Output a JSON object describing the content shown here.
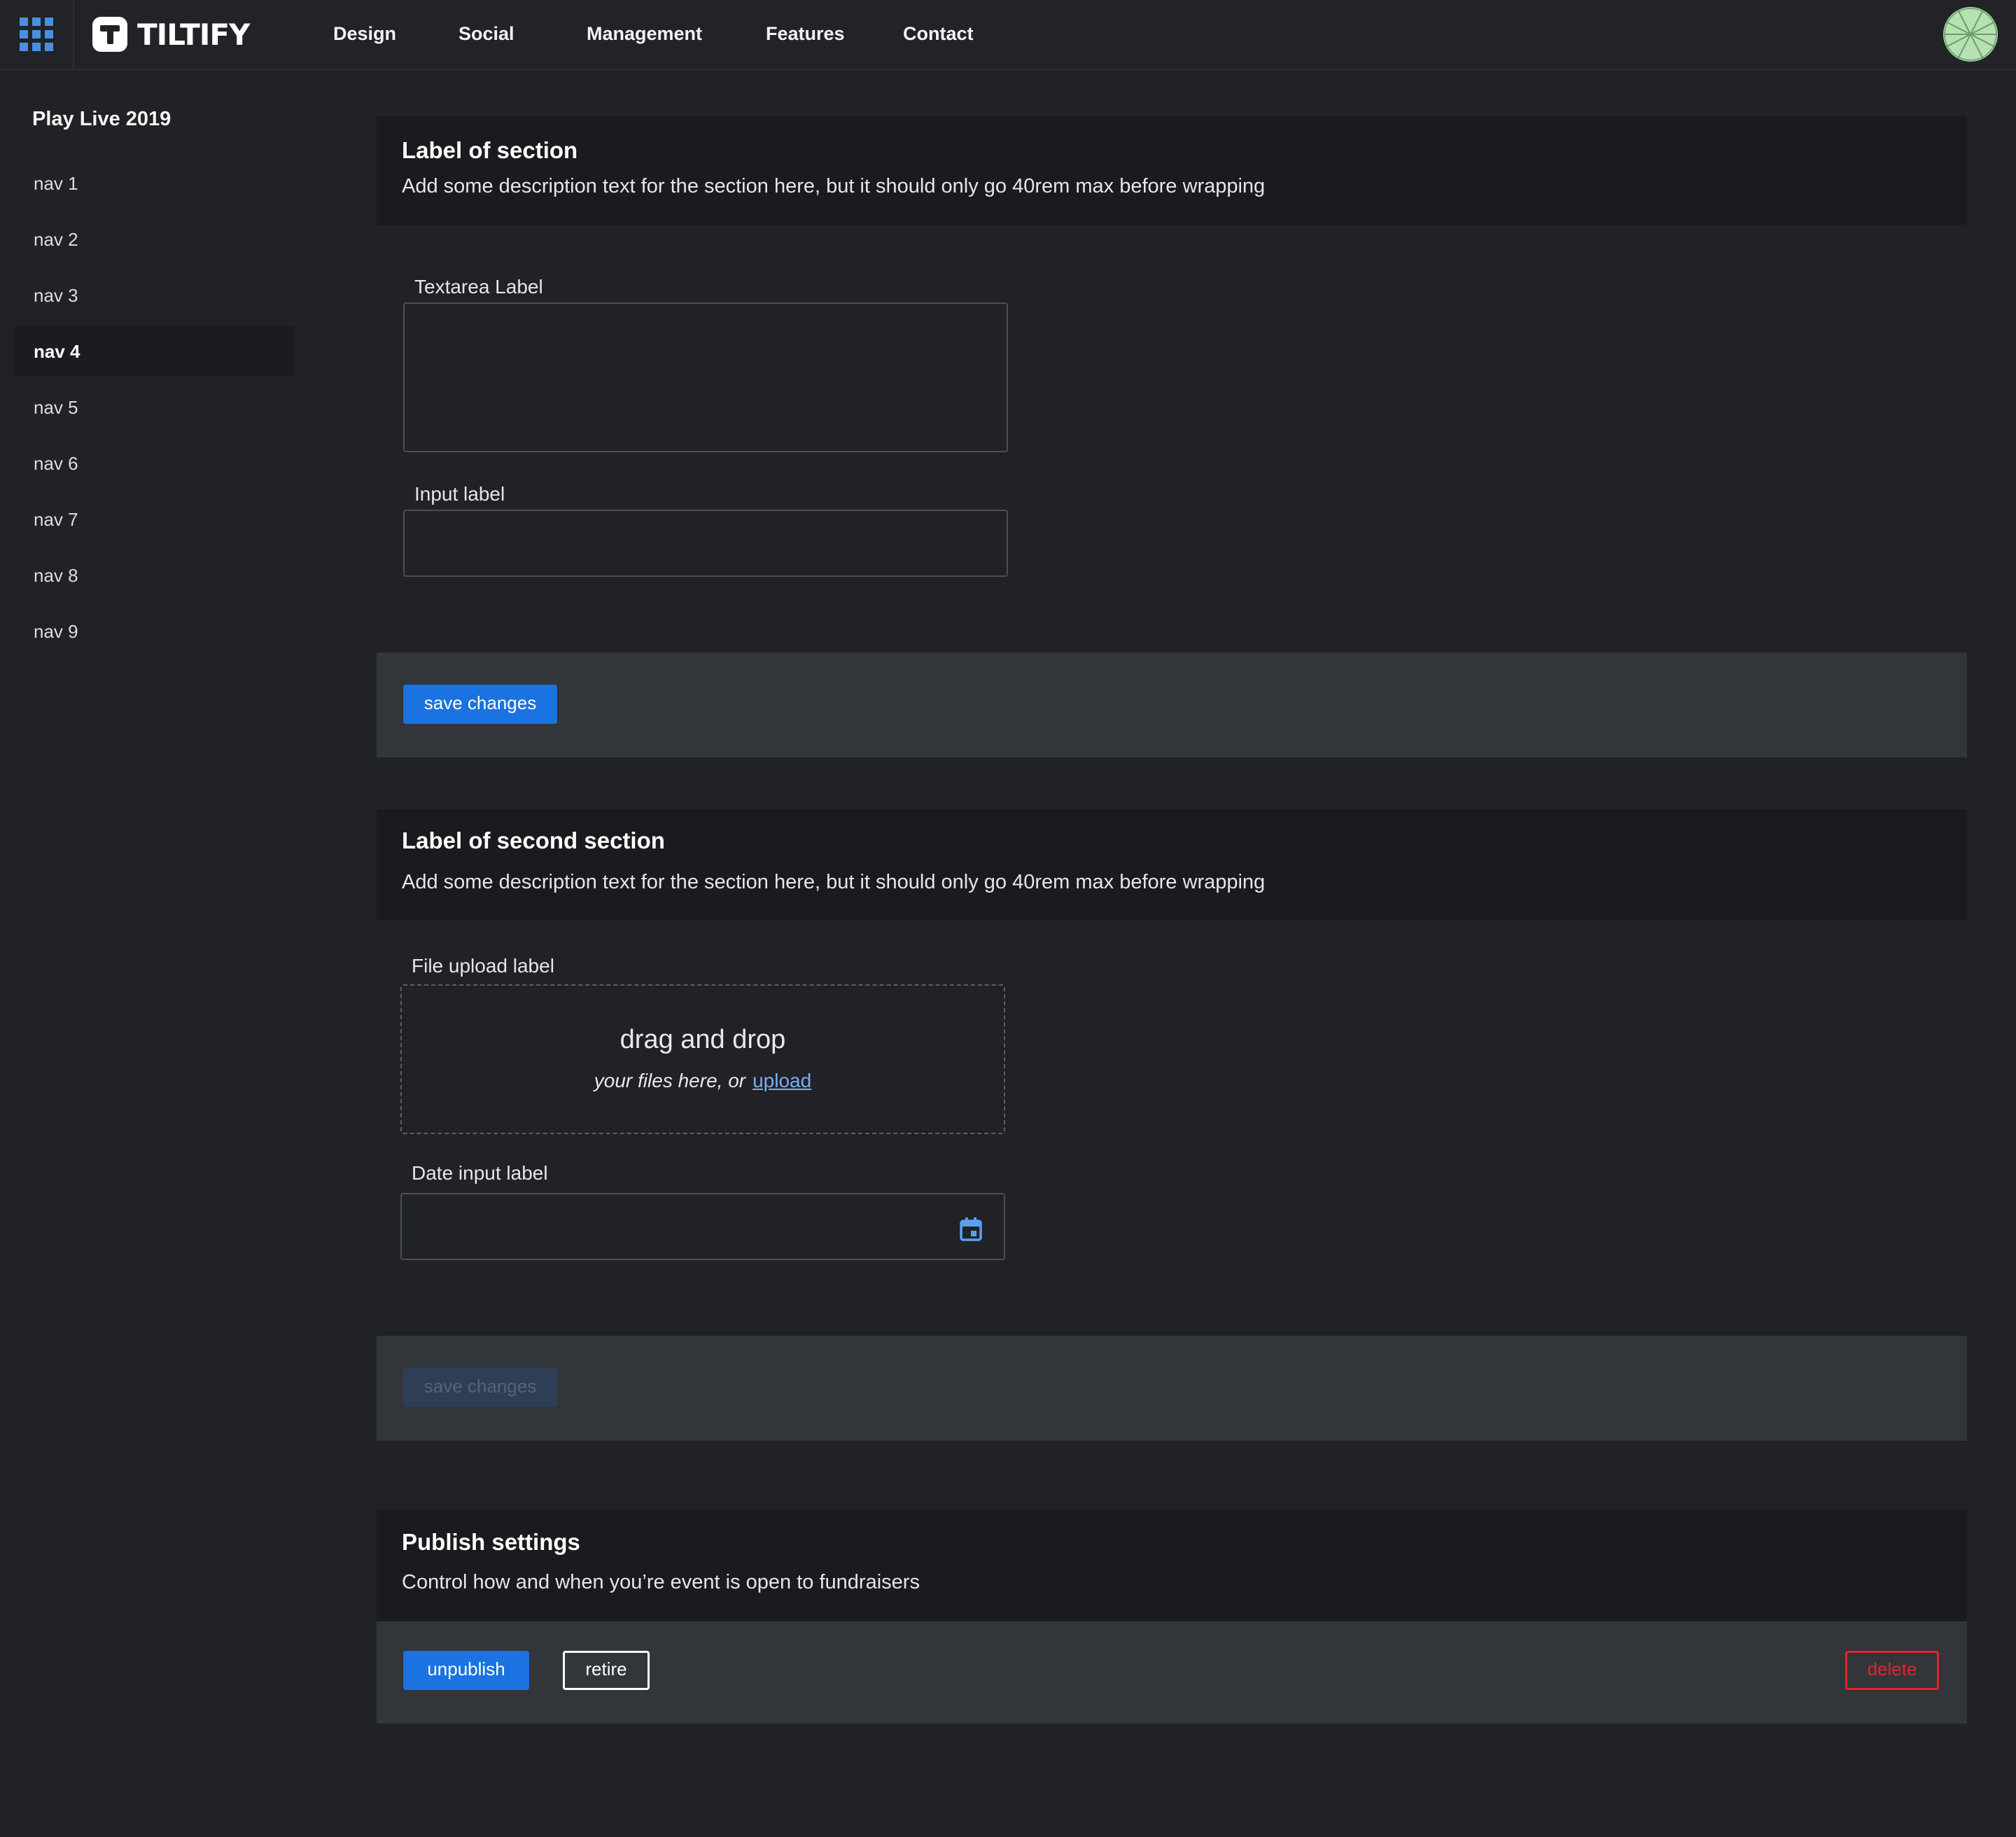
{
  "header": {
    "brand": "TILTIFY",
    "nav": [
      "Design",
      "Social",
      "Management",
      "Features",
      "Contact"
    ]
  },
  "sidebar": {
    "title": "Play Live 2019",
    "items": [
      "nav 1",
      "nav 2",
      "nav 3",
      "nav 4",
      "nav 5",
      "nav 6",
      "nav 7",
      "nav 8",
      "nav 9"
    ],
    "active": "nav 4"
  },
  "section1": {
    "title": "Label of section",
    "description": "Add some description text for the section here, but it should only go 40rem max before wrapping",
    "textarea_label": "Textarea Label",
    "textarea_value": "",
    "input_label": "Input label",
    "input_value": "",
    "save_label": "save changes"
  },
  "section2": {
    "title": "Label of second section",
    "description": "Add some description text for the section here, but it should only go 40rem max before wrapping",
    "upload_label": "File upload label",
    "upload_title": "drag and drop",
    "upload_sub": "your files here, or",
    "upload_link": "upload",
    "date_label": "Date input label",
    "date_value": "",
    "save_label": "save changes"
  },
  "publish": {
    "title": "Publish settings",
    "description": "Control how and when you’re event is open to fundraisers",
    "unpublish_label": "unpublish",
    "retire_label": "retire",
    "delete_label": "delete"
  },
  "colors": {
    "accent": "#1a73e0",
    "danger": "#e0262b",
    "background": "#202225"
  }
}
